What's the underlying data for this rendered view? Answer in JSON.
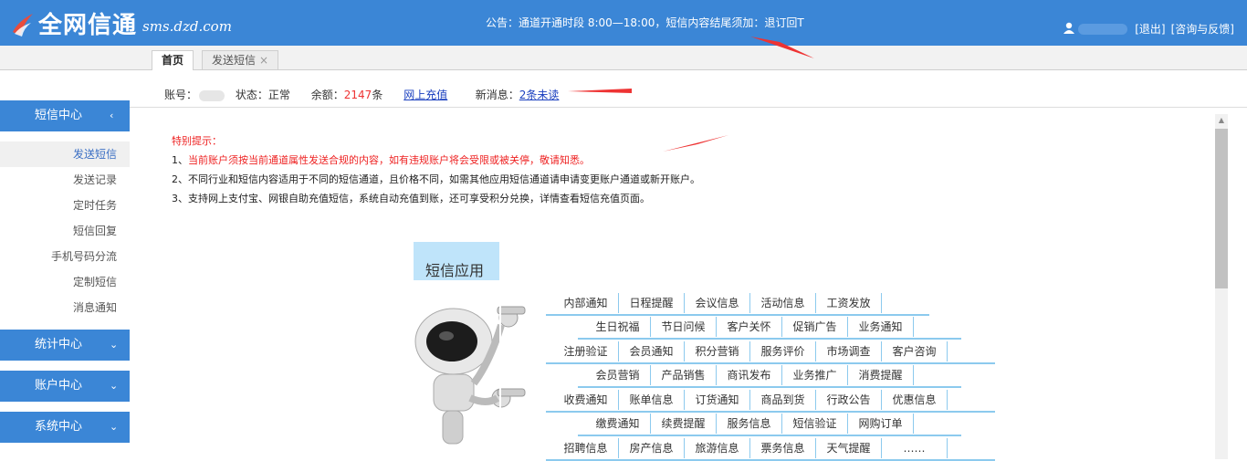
{
  "header": {
    "logo_text": "全网信通",
    "logo_url": "sms.dzd.com",
    "notice": "公告：通道开通时段 8:00—18:00，短信内容结尾须加：退订回T",
    "logout": "[退出]",
    "consult": "[咨询与反馈]"
  },
  "tabs": [
    {
      "label": "首页"
    },
    {
      "label": "发送短信",
      "close": "×"
    }
  ],
  "sidebar": {
    "sms_center": "短信中心",
    "collapse_chevron": "‹",
    "items": [
      "发送短信",
      "发送记录",
      "定时任务",
      "短信回复",
      "手机号码分流",
      "定制短信",
      "消息通知"
    ],
    "stats_center": "统计中心",
    "account_center": "账户中心",
    "system_center": "系统中心",
    "expand_chevron": "⌄"
  },
  "info": {
    "account_label": "账号：",
    "status_label": "状态：",
    "status_value": "正常",
    "balance_label": "余额：",
    "balance_value": "2147",
    "balance_unit": "条",
    "recharge_link": "网上充值",
    "new_msg_label": "新消息：",
    "new_msg_link": "2条未读"
  },
  "notes": {
    "heading": "特别提示：",
    "line1_prefix": "1、",
    "line1": "当前账户须按当前通道属性发送合规的内容，如有违规账户将会受限或被关停，敬请知悉。",
    "line2": "2、不同行业和短信内容适用于不同的短信通道，且价格不同，如需其他应用短信通道请申请变更账户通道或新开账户。",
    "line3": "3、支持网上支付宝、网银自助充值短信，系统自动充值到账，还可享受积分兑换，详情查看短信充值页面。"
  },
  "app": {
    "title": "短信应用",
    "rows": [
      [
        "内部通知",
        "日程提醒",
        "会议信息",
        "活动信息",
        "工资发放"
      ],
      [
        "生日祝福",
        "节日问候",
        "客户关怀",
        "促销广告",
        "业务通知"
      ],
      [
        "注册验证",
        "会员通知",
        "积分营销",
        "服务评价",
        "市场调查",
        "客户咨询"
      ],
      [
        "会员营销",
        "产品销售",
        "商讯发布",
        "业务推广",
        "消费提醒"
      ],
      [
        "收费通知",
        "账单信息",
        "订货通知",
        "商品到货",
        "行政公告",
        "优惠信息"
      ],
      [
        "缴费通知",
        "续费提醒",
        "服务信息",
        "短信验证",
        "网购订单"
      ],
      [
        "招聘信息",
        "房产信息",
        "旅游信息",
        "票务信息",
        "天气提醒",
        "……"
      ]
    ]
  },
  "colors": {
    "brand_blue": "#3b86d6",
    "alert_red": "#e22222",
    "app_light_blue": "#bfe4fa",
    "line_blue": "#8ccaee"
  }
}
